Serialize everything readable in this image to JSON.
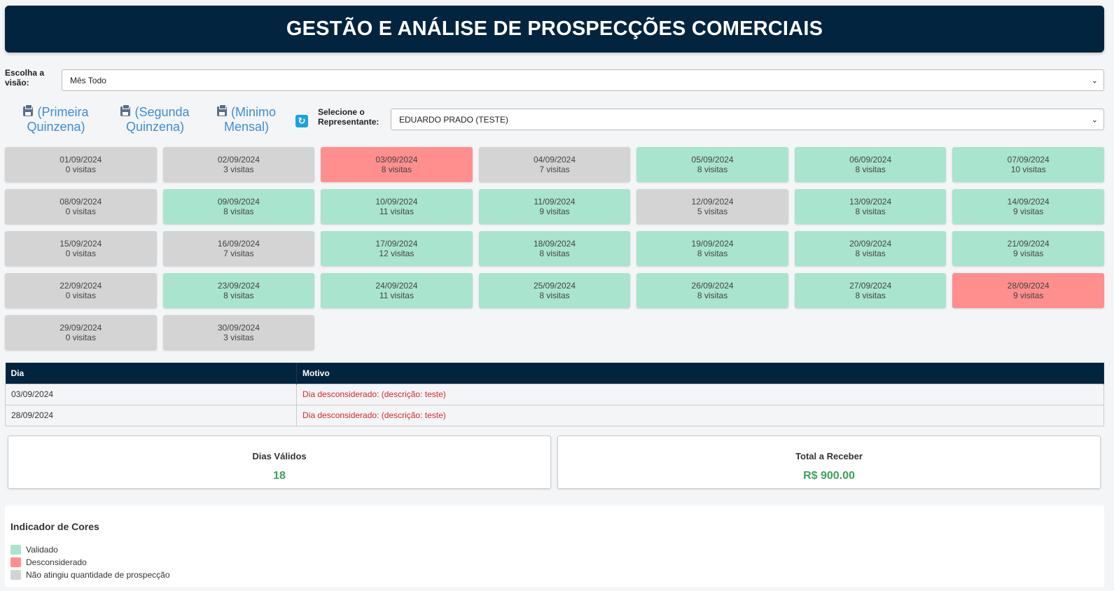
{
  "header": {
    "title": "GESTÃO E ANÁLISE DE PROSPECÇÕES COMERCIAIS"
  },
  "vision": {
    "label_line1": "Escolha a",
    "label_line2": "visão:",
    "selected": "Mês Todo"
  },
  "print_links": [
    {
      "line1": "(Primeira",
      "line2": "Quinzena)",
      "icon": "printer-icon"
    },
    {
      "line1": "(Segunda",
      "line2": "Quinzena)",
      "icon": "printer-icon"
    },
    {
      "line1": "(Minimo",
      "line2": "Mensal)",
      "icon": "printer-icon"
    }
  ],
  "refresh": {
    "icon": "refresh-icon"
  },
  "representative": {
    "label_line1": "Selecione o",
    "label_line2": "Representante:",
    "selected": "EDUARDO PRADO (TESTE)"
  },
  "colors": {
    "validado": "#a9e5ce",
    "desconsiderado": "#ff8e8e",
    "nao_atingiu": "#d4d4d4",
    "header": "#02243f"
  },
  "days": [
    {
      "date": "01/09/2024",
      "visits": "0 visitas",
      "status": "gray"
    },
    {
      "date": "02/09/2024",
      "visits": "3 visitas",
      "status": "gray"
    },
    {
      "date": "03/09/2024",
      "visits": "8 visitas",
      "status": "red"
    },
    {
      "date": "04/09/2024",
      "visits": "7 visitas",
      "status": "gray"
    },
    {
      "date": "05/09/2024",
      "visits": "8 visitas",
      "status": "green"
    },
    {
      "date": "06/09/2024",
      "visits": "8 visitas",
      "status": "green"
    },
    {
      "date": "07/09/2024",
      "visits": "10 visitas",
      "status": "green"
    },
    {
      "date": "08/09/2024",
      "visits": "0 visitas",
      "status": "gray"
    },
    {
      "date": "09/09/2024",
      "visits": "8 visitas",
      "status": "green"
    },
    {
      "date": "10/09/2024",
      "visits": "11 visitas",
      "status": "green"
    },
    {
      "date": "11/09/2024",
      "visits": "9 visitas",
      "status": "green"
    },
    {
      "date": "12/09/2024",
      "visits": "5 visitas",
      "status": "gray"
    },
    {
      "date": "13/09/2024",
      "visits": "8 visitas",
      "status": "green"
    },
    {
      "date": "14/09/2024",
      "visits": "9 visitas",
      "status": "green"
    },
    {
      "date": "15/09/2024",
      "visits": "0 visitas",
      "status": "gray"
    },
    {
      "date": "16/09/2024",
      "visits": "7 visitas",
      "status": "gray"
    },
    {
      "date": "17/09/2024",
      "visits": "12 visitas",
      "status": "green"
    },
    {
      "date": "18/09/2024",
      "visits": "8 visitas",
      "status": "green"
    },
    {
      "date": "19/09/2024",
      "visits": "8 visitas",
      "status": "green"
    },
    {
      "date": "20/09/2024",
      "visits": "8 visitas",
      "status": "green"
    },
    {
      "date": "21/09/2024",
      "visits": "9 visitas",
      "status": "green"
    },
    {
      "date": "22/09/2024",
      "visits": "0 visitas",
      "status": "gray"
    },
    {
      "date": "23/09/2024",
      "visits": "8 visitas",
      "status": "green"
    },
    {
      "date": "24/09/2024",
      "visits": "11 visitas",
      "status": "green"
    },
    {
      "date": "25/09/2024",
      "visits": "8 visitas",
      "status": "green"
    },
    {
      "date": "26/09/2024",
      "visits": "8 visitas",
      "status": "green"
    },
    {
      "date": "27/09/2024",
      "visits": "8 visitas",
      "status": "green"
    },
    {
      "date": "28/09/2024",
      "visits": "9 visitas",
      "status": "red"
    },
    {
      "date": "29/09/2024",
      "visits": "0 visitas",
      "status": "gray"
    },
    {
      "date": "30/09/2024",
      "visits": "3 visitas",
      "status": "gray"
    }
  ],
  "motivos": {
    "headers": [
      "Dia",
      "Motivo"
    ],
    "rows": [
      {
        "dia": "03/09/2024",
        "motivo": "Dia desconsiderado: (descrição: teste)"
      },
      {
        "dia": "28/09/2024",
        "motivo": "Dia desconsiderado: (descrição: teste)"
      }
    ]
  },
  "stats": {
    "dias_validos": {
      "label": "Dias Válidos",
      "value": "18"
    },
    "total_receber": {
      "label": "Total a Receber",
      "value": "R$ 900.00"
    }
  },
  "legend": {
    "title": "Indicador de Cores",
    "items": [
      {
        "label": "Validado",
        "status": "green"
      },
      {
        "label": "Desconsiderado",
        "status": "red"
      },
      {
        "label": "Não atingiu quantidade de prospecção",
        "status": "gray"
      }
    ]
  }
}
